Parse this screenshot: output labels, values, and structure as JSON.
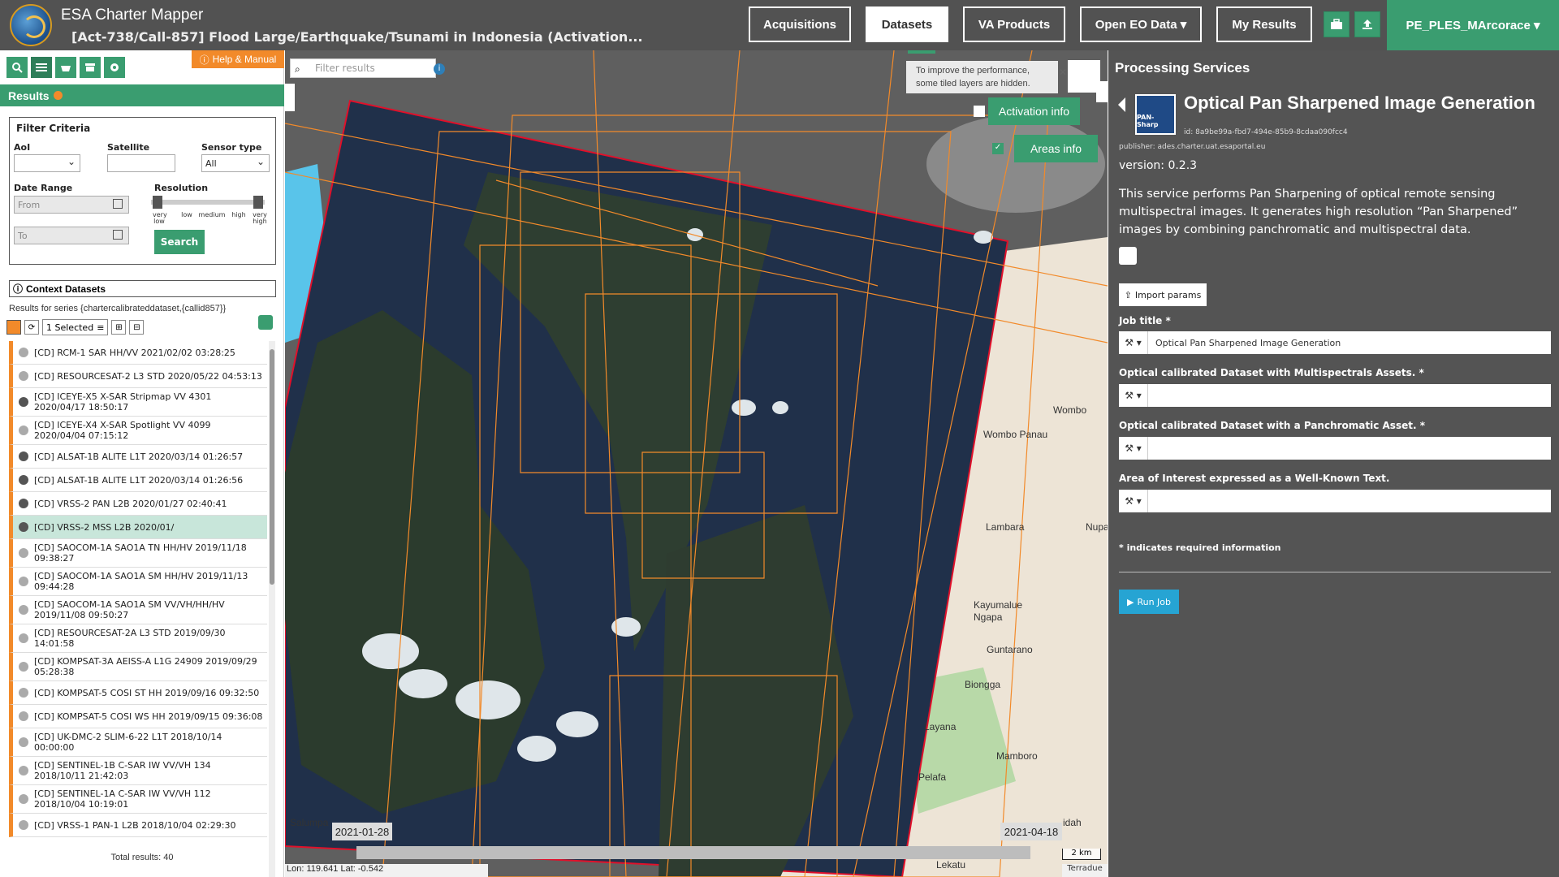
{
  "header": {
    "app_title": "ESA Charter Mapper",
    "activation_title": "[Act-738/Call-857] Flood Large/Earthquake/Tsunami in Indonesia (Activation...",
    "nav": [
      "Acquisitions",
      "Datasets",
      "VA Products",
      "Open EO Data ▾",
      "My Results"
    ],
    "active_nav": "Datasets",
    "user": "PE_PLES_MArcorace ▾"
  },
  "left": {
    "help_label": "Help & Manual",
    "results_label": "Results",
    "filter": {
      "title": "Filter Criteria",
      "aoi_label": "AoI",
      "satellite_label": "Satellite",
      "sensor_label": "Sensor type",
      "sensor_value": "All",
      "date_label": "Date Range",
      "from_placeholder": "From",
      "to_placeholder": "To",
      "resolution_label": "Resolution",
      "ticks": [
        "very low",
        "low",
        "medium",
        "high",
        "very high"
      ],
      "search_label": "Search"
    },
    "context_label": "Context Datasets",
    "series_text": "Results for series {chartercalibrateddataset,{callid857}}",
    "selected_label": "1 Selected",
    "items": [
      {
        "text": "[CD] RCM-1 SAR HH/VV 2021/02/02 03:28:25",
        "dot": "light"
      },
      {
        "text": "[CD] RESOURCESAT-2 L3 STD 2020/05/22 04:53:13",
        "dot": "light"
      },
      {
        "text": "[CD] ICEYE-X5 X-SAR Stripmap VV 4301 2020/04/17 18:50:17",
        "dot": "dark"
      },
      {
        "text": "[CD] ICEYE-X4 X-SAR Spotlight VV 4099 2020/04/04 07:15:12",
        "dot": "light"
      },
      {
        "text": "[CD] ALSAT-1B ALITE L1T 2020/03/14 01:26:57",
        "dot": "dark"
      },
      {
        "text": "[CD] ALSAT-1B ALITE L1T 2020/03/14 01:26:56",
        "dot": "dark"
      },
      {
        "text": "[CD] VRSS-2 PAN L2B 2020/01/27 02:40:41",
        "dot": "dark"
      },
      {
        "text": "[CD] VRSS-2 MSS L2B 2020/01/",
        "dot": "dark",
        "selected": true
      },
      {
        "text": "[CD] SAOCOM-1A SAO1A TN HH/HV 2019/11/18 09:38:27",
        "dot": "light"
      },
      {
        "text": "[CD] SAOCOM-1A SAO1A SM HH/HV 2019/11/13 09:44:28",
        "dot": "light"
      },
      {
        "text": "[CD] SAOCOM-1A SAO1A SM VV/VH/HH/HV 2019/11/08 09:50:27",
        "dot": "light"
      },
      {
        "text": "[CD] RESOURCESAT-2A L3 STD 2019/09/30 14:01:58",
        "dot": "light"
      },
      {
        "text": "[CD] KOMPSAT-3A AEISS-A L1G 24909 2019/09/29 05:28:38",
        "dot": "light"
      },
      {
        "text": "[CD] KOMPSAT-5 COSI ST HH 2019/09/16 09:32:50",
        "dot": "light"
      },
      {
        "text": "[CD] KOMPSAT-5 COSI WS HH 2019/09/15 09:36:08",
        "dot": "light"
      },
      {
        "text": "[CD] UK-DMC-2 SLIM-6-22 L1T 2018/10/14 00:00:00",
        "dot": "light"
      },
      {
        "text": "[CD] SENTINEL-1B C-SAR IW VV/VH 134 2018/10/11 21:42:03",
        "dot": "light"
      },
      {
        "text": "[CD] SENTINEL-1A C-SAR IW VV/VH 112 2018/10/04 10:19:01",
        "dot": "light"
      },
      {
        "text": "[CD] VRSS-1 PAN-1 L2B 2018/10/04 02:29:30",
        "dot": "light"
      }
    ],
    "total": "Total results: 40"
  },
  "map": {
    "filter_placeholder": "Filter results",
    "perf_note": "To improve the performance, some tiled layers are hidden.",
    "activation_info": "Activation info",
    "areas_info": "Areas info",
    "date_start": "2021-01-28",
    "date_end": "2021-04-18",
    "coords": "Lon: 119.641 Lat: -0.542",
    "scale": "2 km",
    "attribution": "Terradue",
    "places": [
      "Wombo",
      "Wombo Panau",
      "Lambara",
      "Nupa",
      "Kayumalue Ngapa",
      "Guntarano",
      "Biongga",
      "Layana",
      "Mamboro",
      "Pelafa",
      "Salumpa",
      "Lekatu",
      "idah"
    ]
  },
  "right": {
    "panel_title": "Processing Services",
    "logo_text": "PAN-Sharp",
    "service_name": "Optical Pan Sharpened Image Generation",
    "service_id": "id: 8a9be99a-fbd7-494e-85b9-8cdaa090fcc4",
    "publisher": "publisher: ades.charter.uat.esaportal.eu",
    "version": "version: 0.2.3",
    "description": "This service performs Pan Sharpening of optical remote sensing multispectral images. It generates high resolution “Pan Sharpened” images by combining panchromatic and multispectral data.",
    "import_label": "Import params",
    "fields": [
      {
        "label": "Job title *",
        "value": "Optical Pan Sharpened Image Generation"
      },
      {
        "label": "Optical calibrated Dataset with Multispectrals Assets. *",
        "value": ""
      },
      {
        "label": "Optical calibrated Dataset with a Panchromatic Asset. *",
        "value": ""
      },
      {
        "label": "Area of Interest expressed as a Well-Known Text.",
        "value": ""
      }
    ],
    "required_note": "* indicates required information",
    "run_label": "Run Job"
  },
  "colors": {
    "green": "#3a9d70",
    "orange": "#f28a2a",
    "header": "#525252",
    "panel": "#545454",
    "run": "#26a4d3"
  }
}
